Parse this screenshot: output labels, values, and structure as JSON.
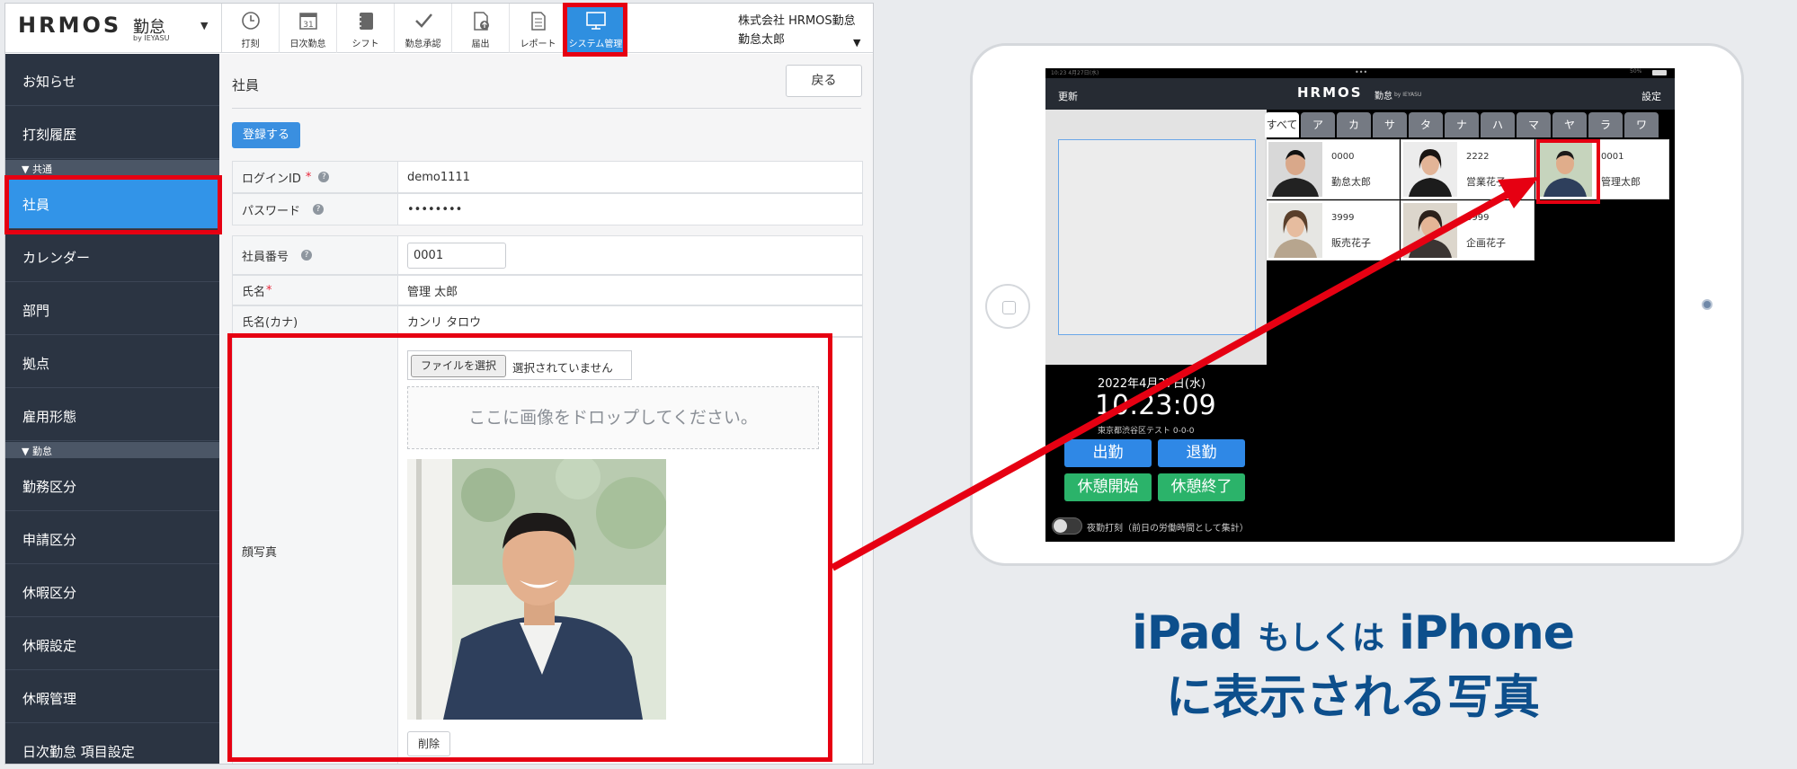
{
  "app": {
    "brand": "HRMOS",
    "product": "勤怠",
    "by": "by IEYASU"
  },
  "toolbar": [
    {
      "label": "打刻",
      "icon": "clock-icon"
    },
    {
      "label": "日次勤怠",
      "icon": "calendar-icon"
    },
    {
      "label": "シフト",
      "icon": "notebook-icon"
    },
    {
      "label": "勤怠承認",
      "icon": "check-icon"
    },
    {
      "label": "届出",
      "icon": "document-upload-icon"
    },
    {
      "label": "レポート",
      "icon": "report-icon"
    },
    {
      "label": "システム管理",
      "icon": "monitor-icon",
      "active": true
    }
  ],
  "calendar_day": "31",
  "company": {
    "name": "株式会社 HRMOS勤怠",
    "user": "勤怠太郎"
  },
  "sidebar": {
    "items_top": [
      "お知らせ",
      "打刻履歴"
    ],
    "section_common": "▼ 共通",
    "items_common": [
      "社員",
      "カレンダー",
      "部門",
      "拠点",
      "雇用形態"
    ],
    "section_kintai": "▼ 勤怠",
    "items_kintai": [
      "勤務区分",
      "申請区分",
      "休暇区分",
      "休暇設定",
      "休暇管理",
      "日次勤怠 項目設定"
    ]
  },
  "page": {
    "title": "社員",
    "back": "戻る",
    "register": "登録する",
    "fields": {
      "login_id_label": "ログインID",
      "login_id_req": "*",
      "login_id_value": "demo1111",
      "password_label": "パスワード",
      "password_value": "••••••••",
      "emp_no_label": "社員番号",
      "emp_no_value": "0001",
      "name_label": "氏名",
      "name_req": "*",
      "name_value": "管理 太郎",
      "kana_label": "氏名(カナ)",
      "kana_value": "カンリ タロウ",
      "photo_label": "顔写真",
      "file_button": "ファイルを選択",
      "file_status": "選択されていません",
      "dropzone": "ここに画像をドロップしてください。",
      "delete": "削除"
    },
    "help_glyph": "?"
  },
  "ipad": {
    "status_left": "10:23  4月27日(水)",
    "status_dots": "•••",
    "status_right": "50%",
    "update": "更新",
    "logo": "HRMOS",
    "logo_sub": "勤怠",
    "logo_by": "by IEYASU",
    "settings": "設定",
    "kana_tabs": [
      "すべて",
      "ア",
      "カ",
      "サ",
      "タ",
      "ナ",
      "ハ",
      "マ",
      "ヤ",
      "ラ",
      "ワ"
    ],
    "employees": [
      {
        "no": "0000",
        "name": "勤怠太郎"
      },
      {
        "no": "2222",
        "name": "営業花子"
      },
      {
        "no": "0001",
        "name": "管理太郎"
      },
      {
        "no": "3999",
        "name": "販売花子"
      },
      {
        "no": "3999",
        "name": "企画花子"
      }
    ],
    "date": "2022年4月27日(水)",
    "time": "10:23:09",
    "address": "東京都渋谷区テスト 0-0-0",
    "buttons": {
      "in": "出勤",
      "out": "退勤",
      "break_start": "休憩開始",
      "break_end": "休憩終了"
    },
    "night_toggle": "夜勤打刻（前日の労働時間として集計）"
  },
  "caption": {
    "l1a": "iPad",
    "l1b": "もしくは",
    "l1c": "iPhone",
    "l2": "に表示される写真"
  },
  "colors": {
    "highlight": "#e60012",
    "accent": "#3294e8",
    "caption": "#0d4f8c",
    "sidebar": "#2b3442"
  }
}
